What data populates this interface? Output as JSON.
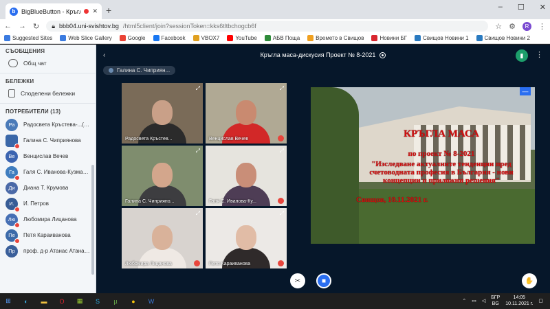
{
  "browser": {
    "tab_title": "BigBlueButton - Кръгла мас...",
    "url_host": "bbb04.uni-svishtov.bg",
    "url_path": "/html5client/join?sessionToken=kks6tltbchogcb6f",
    "profile_initial": "R",
    "bookmarks": [
      {
        "label": "Suggested Sites",
        "color": "#3b7be0"
      },
      {
        "label": "Web Slice Gallery",
        "color": "#3b7be0"
      },
      {
        "label": "Google",
        "color": "#ea4335"
      },
      {
        "label": "Facebook",
        "color": "#1877f2"
      },
      {
        "label": "VBOX7",
        "color": "#e0a020"
      },
      {
        "label": "YouTube",
        "color": "#ff0000"
      },
      {
        "label": "АБВ Поща",
        "color": "#2e8b3a"
      },
      {
        "label": "Времето в Свищов",
        "color": "#f0a020"
      },
      {
        "label": "Новини БГ",
        "color": "#d8262e"
      },
      {
        "label": "Свищов Новини 1",
        "color": "#2a7ac0"
      },
      {
        "label": "Свищов Новини 2",
        "color": "#2a7ac0"
      }
    ]
  },
  "sidebar": {
    "messages_header": "СЪОБЩЕНИЯ",
    "public_chat": "Общ чат",
    "notes_header": "БЕЛЕЖКИ",
    "shared_notes": "Споделени бележки",
    "users_header": "ПОТРЕБИТЕЛИ (13)",
    "users": [
      {
        "initials": "Ра",
        "name": "Радосвета Кръстева-...(Вие)",
        "color": "#4a7ab8",
        "mic": false,
        "sq": false
      },
      {
        "initials": "",
        "name": "Галина С. Чиприянова",
        "color": "#3a67a8",
        "mic": true,
        "sq": true
      },
      {
        "initials": "Ве",
        "name": "Венцислав Вечев",
        "color": "#3b64b0",
        "mic": false,
        "sq": false
      },
      {
        "initials": "Га",
        "name": "Галя С. Иванова-Кузманова",
        "color": "#3f7dbf",
        "mic": true,
        "sq": false
      },
      {
        "initials": "Ди",
        "name": "Диана Т. Крумова",
        "color": "#4b6aa8",
        "mic": false,
        "sq": false
      },
      {
        "initials": "И.",
        "name": "И. Петров",
        "color": "#375c96",
        "mic": true,
        "sq": false
      },
      {
        "initials": "Лю",
        "name": "Любомира Лицанова",
        "color": "#466fb4",
        "mic": true,
        "sq": false
      },
      {
        "initials": "Пе",
        "name": "Петя Караиванова",
        "color": "#3c6aa9",
        "mic": true,
        "sq": false
      },
      {
        "initials": "Пр",
        "name": "проф. д-р Атанас Атанасов",
        "color": "#3a5f9a",
        "mic": false,
        "sq": false
      }
    ]
  },
  "meeting": {
    "title": "Кръгла маса-дискусия Проект № 8-2021",
    "talking": "Галина С. Чиприян..."
  },
  "videos": [
    {
      "name": "Радосвета Кръстев...",
      "bg": "#7a6b58",
      "face": "#c9a088",
      "body": "#2b2b2b",
      "mic": false
    },
    {
      "name": "Венцислав Вечев",
      "bg": "#b0a994",
      "face": "#c98a70",
      "body": "#d22828",
      "mic": true
    },
    {
      "name": "Галина С. Чиприяно...",
      "bg": "#7f8d6e",
      "face": "#d3a68c",
      "body": "#3d3d40",
      "mic": false
    },
    {
      "name": "Галя С. Иванова-Ку...",
      "bg": "#e6e4de",
      "face": "#c98e78",
      "body": "#4e3d55",
      "mic": true
    },
    {
      "name": "Любомира Лицанова",
      "bg": "#d8d3cf",
      "face": "#d9b29a",
      "body": "#efe9e4",
      "mic": true
    },
    {
      "name": "Петя Караиванова",
      "bg": "#ece9e6",
      "face": "#e1bca6",
      "body": "#2f2a2a",
      "mic": true
    }
  ],
  "slide": {
    "title": "КРЪГЛА МАСА",
    "line1": "по проект № 8-2021",
    "line2": "\"Изследване актуалните тенденции пред счетоводната професия в България - нови концепции и приложни решения\"",
    "footer": "Свищов, 10.11.2021 г."
  },
  "taskbar": {
    "lang1": "БГР",
    "lang2": "BG",
    "time": "14:05",
    "date": "10.11.2021 г."
  }
}
